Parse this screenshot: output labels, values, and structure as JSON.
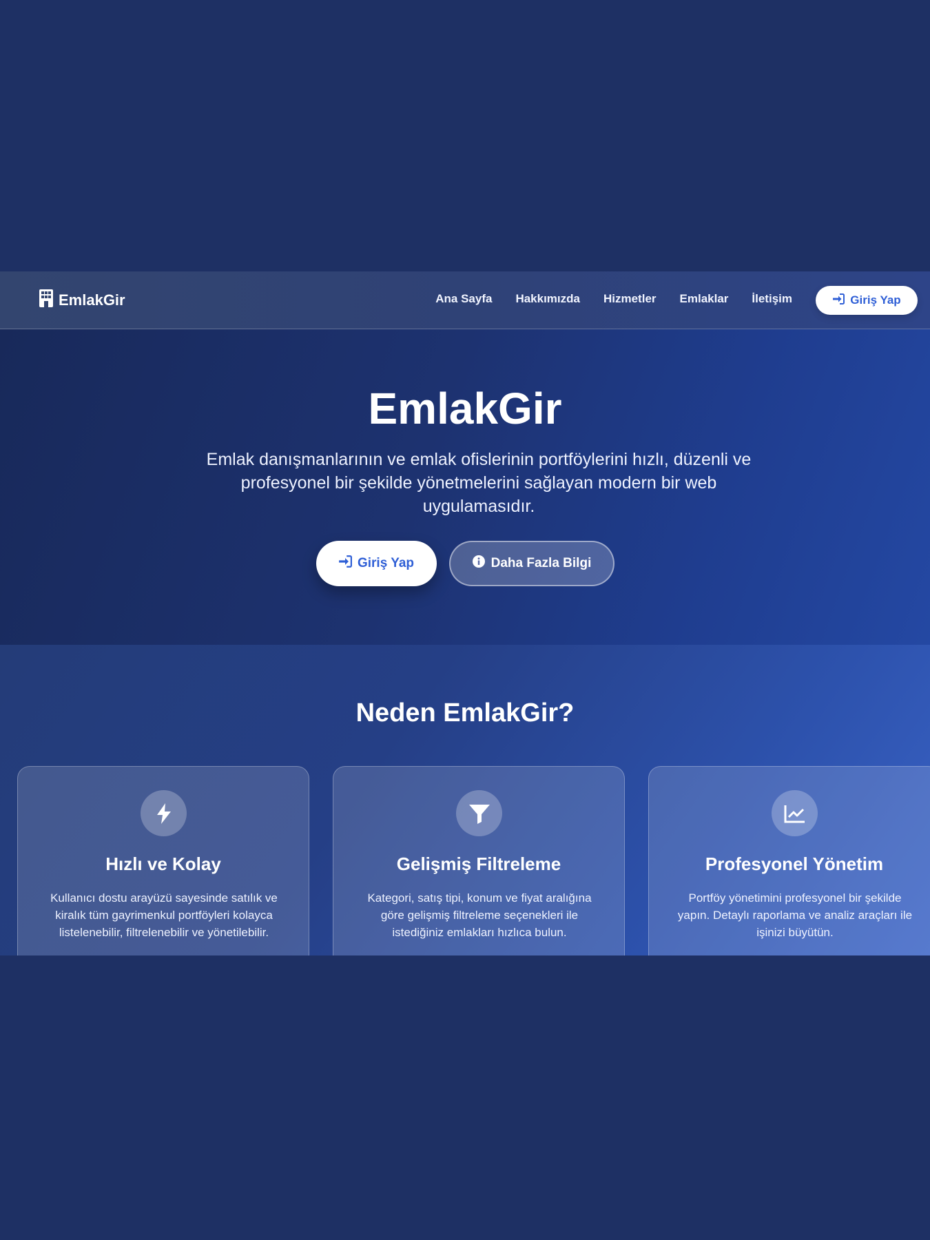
{
  "brand": {
    "name": "EmlakGir",
    "icon": "building-icon"
  },
  "nav": {
    "links": [
      "Ana Sayfa",
      "Hakkımızda",
      "Hizmetler",
      "Emlaklar",
      "İletişim"
    ],
    "login_label": "Giriş Yap"
  },
  "hero": {
    "title": "EmlakGir",
    "subtitle": "Emlak danışmanlarının ve emlak ofislerinin portföylerini hızlı, düzenli ve profesyonel bir şekilde yönetmelerini sağlayan modern bir web uygulamasıdır.",
    "primary_button": "Giriş Yap",
    "secondary_button": "Daha Fazla Bilgi"
  },
  "features": {
    "title": "Neden EmlakGir?",
    "cards": [
      {
        "icon": "bolt-icon",
        "title": "Hızlı ve Kolay",
        "text": "Kullanıcı dostu arayüzü sayesinde satılık ve kiralık tüm gayrimenkul portföyleri kolayca listelenebilir, filtrelenebilir ve yönetilebilir."
      },
      {
        "icon": "filter-icon",
        "title": "Gelişmiş Filtreleme",
        "text": "Kategori, satış tipi, konum ve fiyat aralığına göre gelişmiş filtreleme seçenekleri ile istediğiniz emlakları hızlıca bulun."
      },
      {
        "icon": "chart-line-icon",
        "title": "Profesyonel Yönetim",
        "text": "Portföy yönetimini profesyonel bir şekilde yapın. Detaylı raporlama ve analiz araçları ile işinizi büyütün."
      }
    ]
  },
  "colors": {
    "page_background": "#1e3064",
    "accent": "#2f5fd6",
    "button_background": "#ffffff"
  }
}
